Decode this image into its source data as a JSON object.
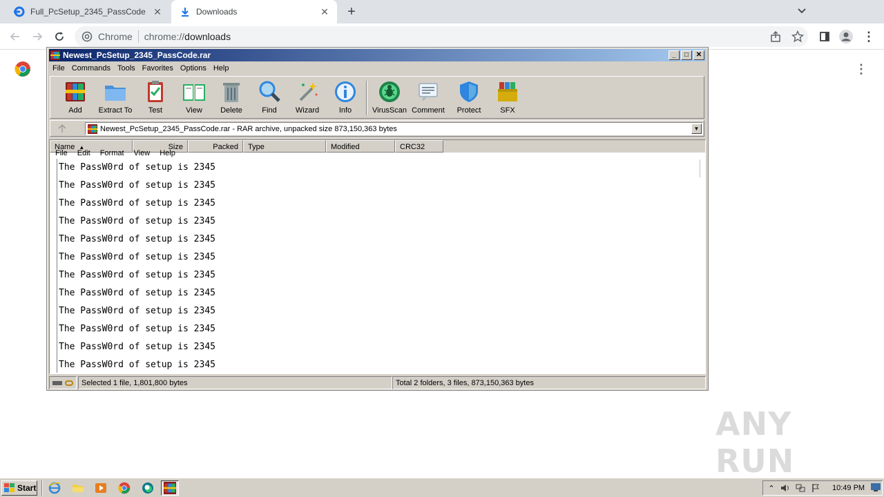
{
  "browser": {
    "tabs": [
      {
        "title": "Full_PcSetup_2345_PassCode",
        "active": false
      },
      {
        "title": "Downloads",
        "active": true
      }
    ],
    "new_tab_label": "+",
    "omnibox": {
      "site_name": "Chrome",
      "url_scheme": "chrome://",
      "url_path": "downloads"
    }
  },
  "winrar": {
    "title": "Newest_PcSetup_2345_PassCode.rar",
    "menu": [
      "File",
      "Commands",
      "Tools",
      "Favorites",
      "Options",
      "Help"
    ],
    "toolbar": [
      {
        "label": "Add",
        "icon": "add-archive-icon"
      },
      {
        "label": "Extract To",
        "icon": "extract-folder-icon"
      },
      {
        "label": "Test",
        "icon": "test-clipboard-icon"
      },
      {
        "label": "View",
        "icon": "view-book-icon"
      },
      {
        "label": "Delete",
        "icon": "trash-icon"
      },
      {
        "label": "Find",
        "icon": "magnifier-icon"
      },
      {
        "label": "Wizard",
        "icon": "magic-wand-icon"
      },
      {
        "label": "Info",
        "icon": "info-icon"
      },
      {
        "label": "VirusScan",
        "icon": "virus-scan-icon"
      },
      {
        "label": "Comment",
        "icon": "comment-icon"
      },
      {
        "label": "Protect",
        "icon": "shield-icon"
      },
      {
        "label": "SFX",
        "icon": "sfx-box-icon"
      }
    ],
    "address": "Newest_PcSetup_2345_PassCode.rar - RAR archive, unpacked size 873,150,363 bytes",
    "columns": [
      "Name",
      "Size",
      "Packed",
      "Type",
      "Modified",
      "CRC32"
    ],
    "overlay_menu": [
      "File",
      "Edit",
      "Format",
      "View",
      "Help"
    ],
    "text_lines": [
      "The PassW0rd of setup is 2345",
      "The PassW0rd of setup is 2345",
      "The PassW0rd of setup is 2345",
      "The PassW0rd of setup is 2345",
      "The PassW0rd of setup is 2345",
      "The PassW0rd of setup is 2345",
      "The PassW0rd of setup is 2345",
      "The PassW0rd of setup is 2345",
      "The PassW0rd of setup is 2345",
      "The PassW0rd of setup is 2345",
      "The PassW0rd of setup is 2345",
      "The PassW0rd of setup is 2345"
    ],
    "status_left": "Selected 1 file, 1,801,800 bytes",
    "status_right": "Total 2 folders, 3 files, 873,150,363 bytes"
  },
  "watermark": "ANY RUN",
  "taskbar": {
    "start_label": "Start",
    "clock": "10:49 PM"
  },
  "colors": {
    "title_bar_start": "#0a246a",
    "title_bar_end": "#a6caf0",
    "win_face": "#d4d0c8",
    "chrome_tabstrip": "#dee1e6"
  }
}
